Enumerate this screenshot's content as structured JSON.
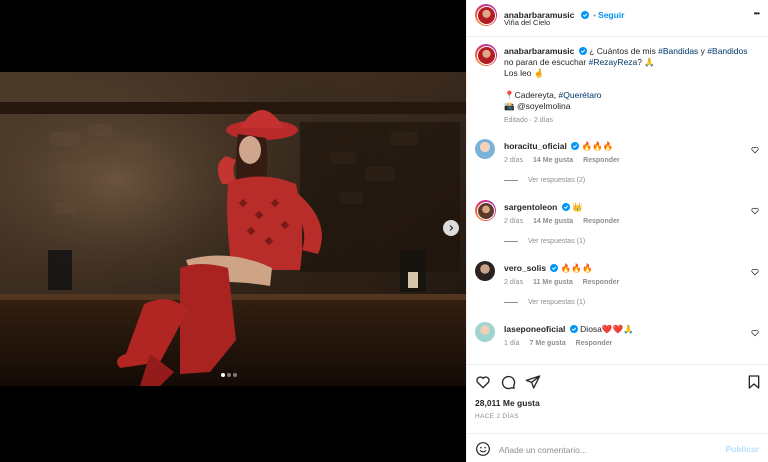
{
  "post": {
    "author": "anabarbaramusic",
    "follow_label": "Seguir",
    "location": "Viña del Cielo",
    "more_label": "•••",
    "caption": {
      "line1_a": "¿ Cuántos de mis ",
      "tag1": "#Bandidas",
      "line1_b": " y ",
      "tag2": "#Bandidos",
      "line2_a": "no paran de escuchar ",
      "tag3": "#RezayReza",
      "line2_b": "? 🙏",
      "line3": "Los leo 🤞",
      "line4_a": "📍Cadereyta, ",
      "tag4": "#Querétaro",
      "line5": "📸 @soyelmolina",
      "edited": "Editado · 2 días"
    },
    "carousel": {
      "total": 3,
      "active": 0
    }
  },
  "comments": [
    {
      "user": "horacitu_oficial",
      "verified": true,
      "text": "🔥🔥🔥",
      "age": "2 días",
      "likes": "14 Me gusta",
      "reply": "Responder",
      "replies": "Ver respuestas (2)"
    },
    {
      "user": "sargentoleon",
      "verified": true,
      "text": "👑",
      "age": "2 días",
      "likes": "14 Me gusta",
      "reply": "Responder",
      "replies": "Ver respuestas (1)"
    },
    {
      "user": "vero_solis",
      "verified": true,
      "text": "🔥🔥🔥",
      "age": "2 días",
      "likes": "11 Me gusta",
      "reply": "Responder",
      "replies": "Ver respuestas (1)"
    },
    {
      "user": "laseponeoficial",
      "verified": true,
      "text": "Diosa❤️❤️🙏",
      "age": "1 día",
      "likes": "7 Me gusta",
      "reply": "Responder",
      "replies": ""
    }
  ],
  "footer": {
    "likes": "28,011 Me gusta",
    "date": "HACE 2 DÍAS",
    "comment_placeholder": "Añade un comentario...",
    "publish_label": "Publicar"
  },
  "icons": {
    "like": "heart-icon",
    "comment": "comment-icon",
    "share": "share-icon",
    "save": "bookmark-icon",
    "emoji": "emoji-icon",
    "next": "chevron-right-icon",
    "verified": "verified-badge-icon"
  },
  "colors": {
    "accent": "#0095f6",
    "link": "#00376b",
    "verified": "#0095f6",
    "muted": "#8e8e8e"
  }
}
